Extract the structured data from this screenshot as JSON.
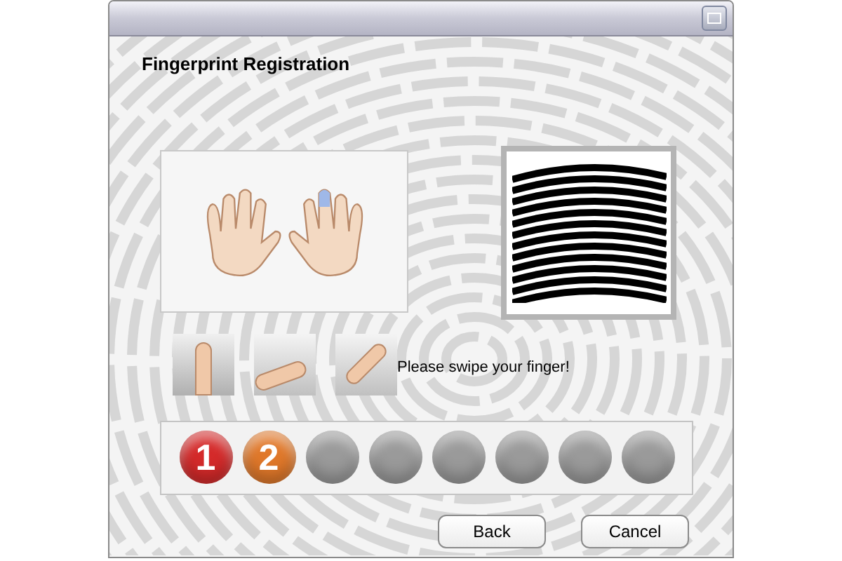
{
  "window": {
    "title": "Fingerprint Registration"
  },
  "instruction": "Please swipe your finger!",
  "progress": [
    {
      "label": "1",
      "color": "#d42a2a"
    },
    {
      "label": "2",
      "color": "#e0782a"
    },
    {
      "color": "#9a9a9a"
    },
    {
      "color": "#9a9a9a"
    },
    {
      "color": "#9a9a9a"
    },
    {
      "color": "#9a9a9a"
    },
    {
      "color": "#9a9a9a"
    },
    {
      "color": "#9a9a9a"
    }
  ],
  "buttons": [
    "Back",
    "Cancel"
  ]
}
